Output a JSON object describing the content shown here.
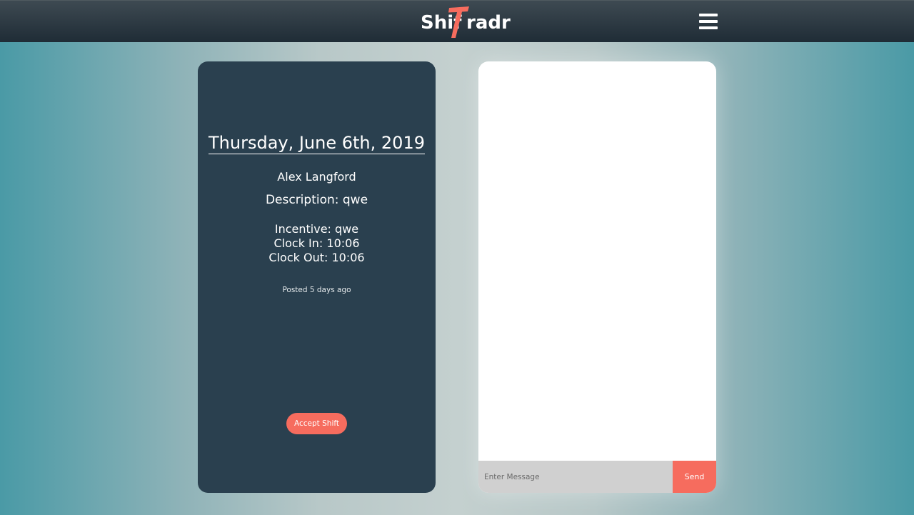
{
  "header": {
    "logo_part1": "Shif",
    "logo_letter": "T",
    "logo_part2": "radr",
    "menu_icon": "hamburger-menu-icon"
  },
  "shift": {
    "date": "Thursday, June 6th, 2019",
    "name": "Alex Langford",
    "description": "Description: qwe",
    "incentive": "Incentive: qwe",
    "clock_in": "Clock In: 10:06",
    "clock_out": "Clock Out: 10:06",
    "posted": "Posted 5 days ago",
    "accept_label": "Accept Shift"
  },
  "chat": {
    "placeholder": "Enter Message",
    "value": "",
    "send_label": "Send"
  },
  "colors": {
    "navbar": "#1f2c36",
    "card": "#2a404f",
    "accent": "#f66c5e",
    "background_edge": "#4a9aa6",
    "input_bg": "#d0d0d0"
  }
}
